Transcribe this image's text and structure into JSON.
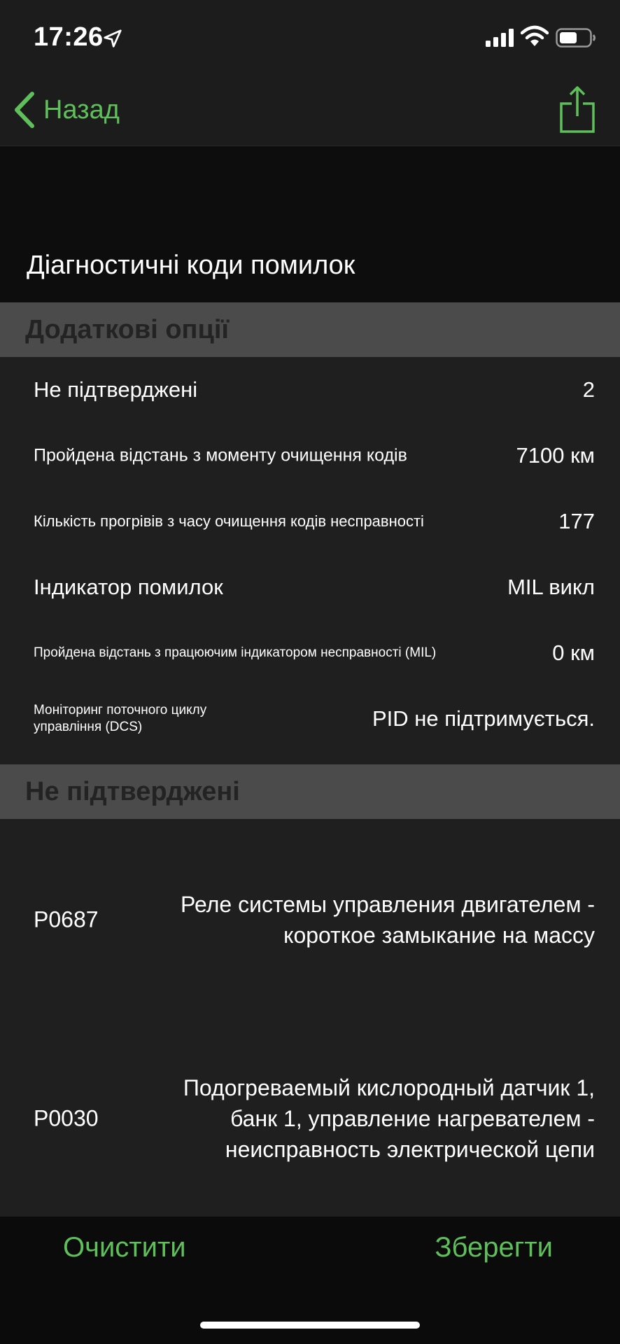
{
  "status_bar": {
    "time": "17:26"
  },
  "nav": {
    "back_label": "Назад",
    "accent_color": "#5fbf5a"
  },
  "page": {
    "title": "Діагностичні коди помилок"
  },
  "sections": {
    "options_header": "Додаткові опції",
    "pending_header": "Не підтверджені"
  },
  "options": [
    {
      "label": "Не підтверджені",
      "value": "2"
    },
    {
      "label": "Пройдена відстань з моменту очищення кодів",
      "value": "7100 км"
    },
    {
      "label": "Кількість прогрівів з часу очищення кодів несправності",
      "value": "177"
    },
    {
      "label": "Індикатор помилок",
      "value": "MIL викл"
    },
    {
      "label": "Пройдена відстань з працюючим індикатором несправності (MIL)",
      "value": "0 км"
    },
    {
      "label": "Моніторинг поточного циклу управління (DCS)",
      "value": "PID не підтримується."
    }
  ],
  "dtcs": [
    {
      "code": "P0687",
      "description": "Реле системы управления двигателем -\nкороткое замыкание на массу"
    },
    {
      "code": "P0030",
      "description": "Подогреваемый кислородный датчик 1,\nбанк 1, управление нагревателем -\nнеисправность электрической цепи"
    }
  ],
  "bottom": {
    "clear_label": "Очистити",
    "save_label": "Зберегти"
  }
}
